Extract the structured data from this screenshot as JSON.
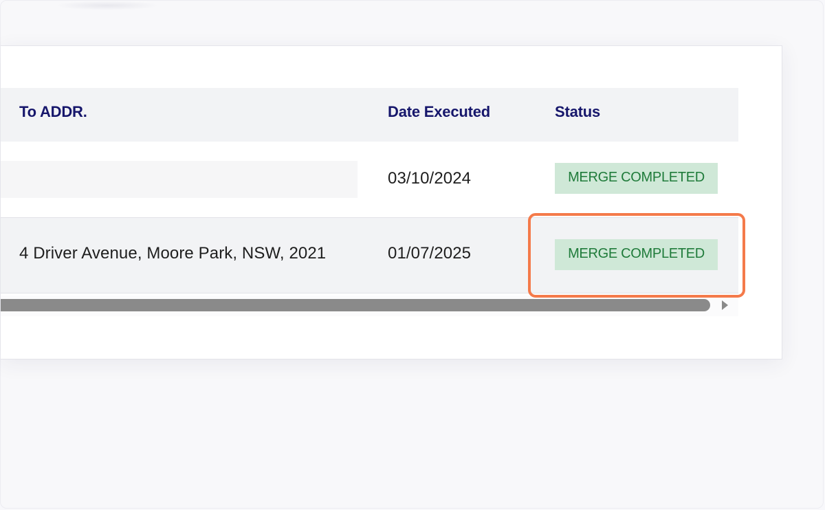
{
  "table": {
    "columns": {
      "to_addr": "To ADDR.",
      "date_executed": "Date Executed",
      "status": "Status"
    },
    "rows": [
      {
        "to_addr": "",
        "date_executed": "03/10/2024",
        "status": "MERGE COMPLETED"
      },
      {
        "to_addr": "4 Driver Avenue, Moore Park, NSW, 2021",
        "date_executed": "01/07/2025",
        "status": "MERGE COMPLETED"
      }
    ]
  },
  "colors": {
    "header_text": "#16166b",
    "status_badge_bg": "#cfe8d7",
    "status_badge_text": "#1f7b3a",
    "highlight_border": "#f47a4a"
  },
  "icons": {
    "scroll_right": "triangle-right-icon"
  }
}
